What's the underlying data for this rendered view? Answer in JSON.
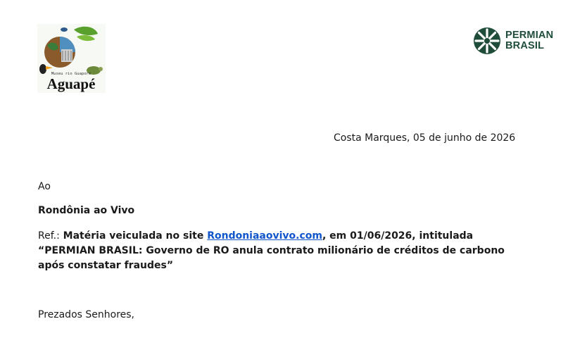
{
  "header": {
    "left_logo": {
      "name": "aguape-logo",
      "subtitle": "Museu rio Guaporé",
      "wordmark": "Aguapé"
    },
    "right_logo": {
      "name": "permian-brasil-logo",
      "line1": "PERMIAN",
      "line2": "BRASIL",
      "color": "#1f4d3a"
    }
  },
  "letter": {
    "date_line": "Costa Marques, 05 de junho de 2026",
    "salutation_to": "Ao",
    "recipient": "Rondônia ao Vivo",
    "ref": {
      "label": "Ref.:",
      "text_before_link": " Matéria veiculada no site ",
      "link_text": "Rondoniaaovivo.com",
      "text_after_link": ", em 01/06/2026, intitulada “PERMIAN BRASIL: Governo de RO anula contrato milionário de créditos de carbono após constatar fraudes”"
    },
    "greeting": "Prezados Senhores,"
  }
}
